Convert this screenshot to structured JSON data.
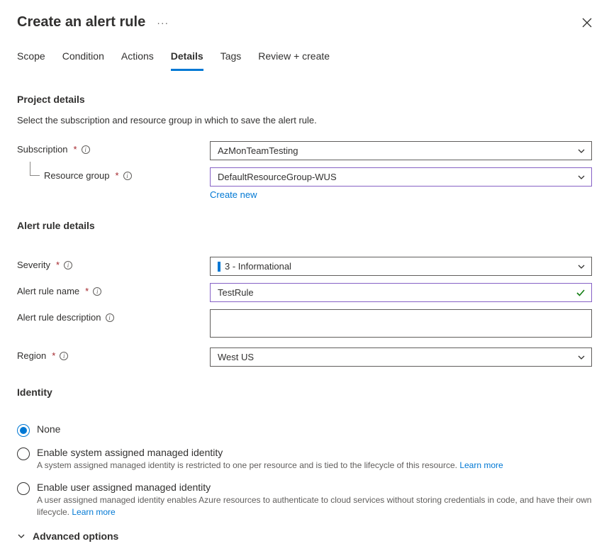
{
  "header": {
    "title": "Create an alert rule"
  },
  "tabs": [
    "Scope",
    "Condition",
    "Actions",
    "Details",
    "Tags",
    "Review + create"
  ],
  "activeTab": "Details",
  "project": {
    "section_title": "Project details",
    "desc": "Select the subscription and resource group in which to save the alert rule.",
    "subscription_label": "Subscription",
    "subscription_value": "AzMonTeamTesting",
    "resource_group_label": "Resource group",
    "resource_group_value": "DefaultResourceGroup-WUS",
    "create_new": "Create new"
  },
  "details": {
    "section_title": "Alert rule details",
    "severity_label": "Severity",
    "severity_value": "3 - Informational",
    "name_label": "Alert rule name",
    "name_value": "TestRule",
    "desc_label": "Alert rule description",
    "desc_value": "",
    "region_label": "Region",
    "region_value": "West US"
  },
  "identity": {
    "section_title": "Identity",
    "options": [
      {
        "label": "None",
        "desc": "",
        "selected": true
      },
      {
        "label": "Enable system assigned managed identity",
        "desc": "A system assigned managed identity is restricted to one per resource and is tied to the lifecycle of this resource. ",
        "learn": "Learn more",
        "selected": false
      },
      {
        "label": "Enable user assigned managed identity",
        "desc": "A user assigned managed identity enables Azure resources to authenticate to cloud services without storing credentials in code, and have their own lifecycle. ",
        "learn": "Learn more",
        "selected": false
      }
    ]
  },
  "advanced_label": "Advanced options"
}
